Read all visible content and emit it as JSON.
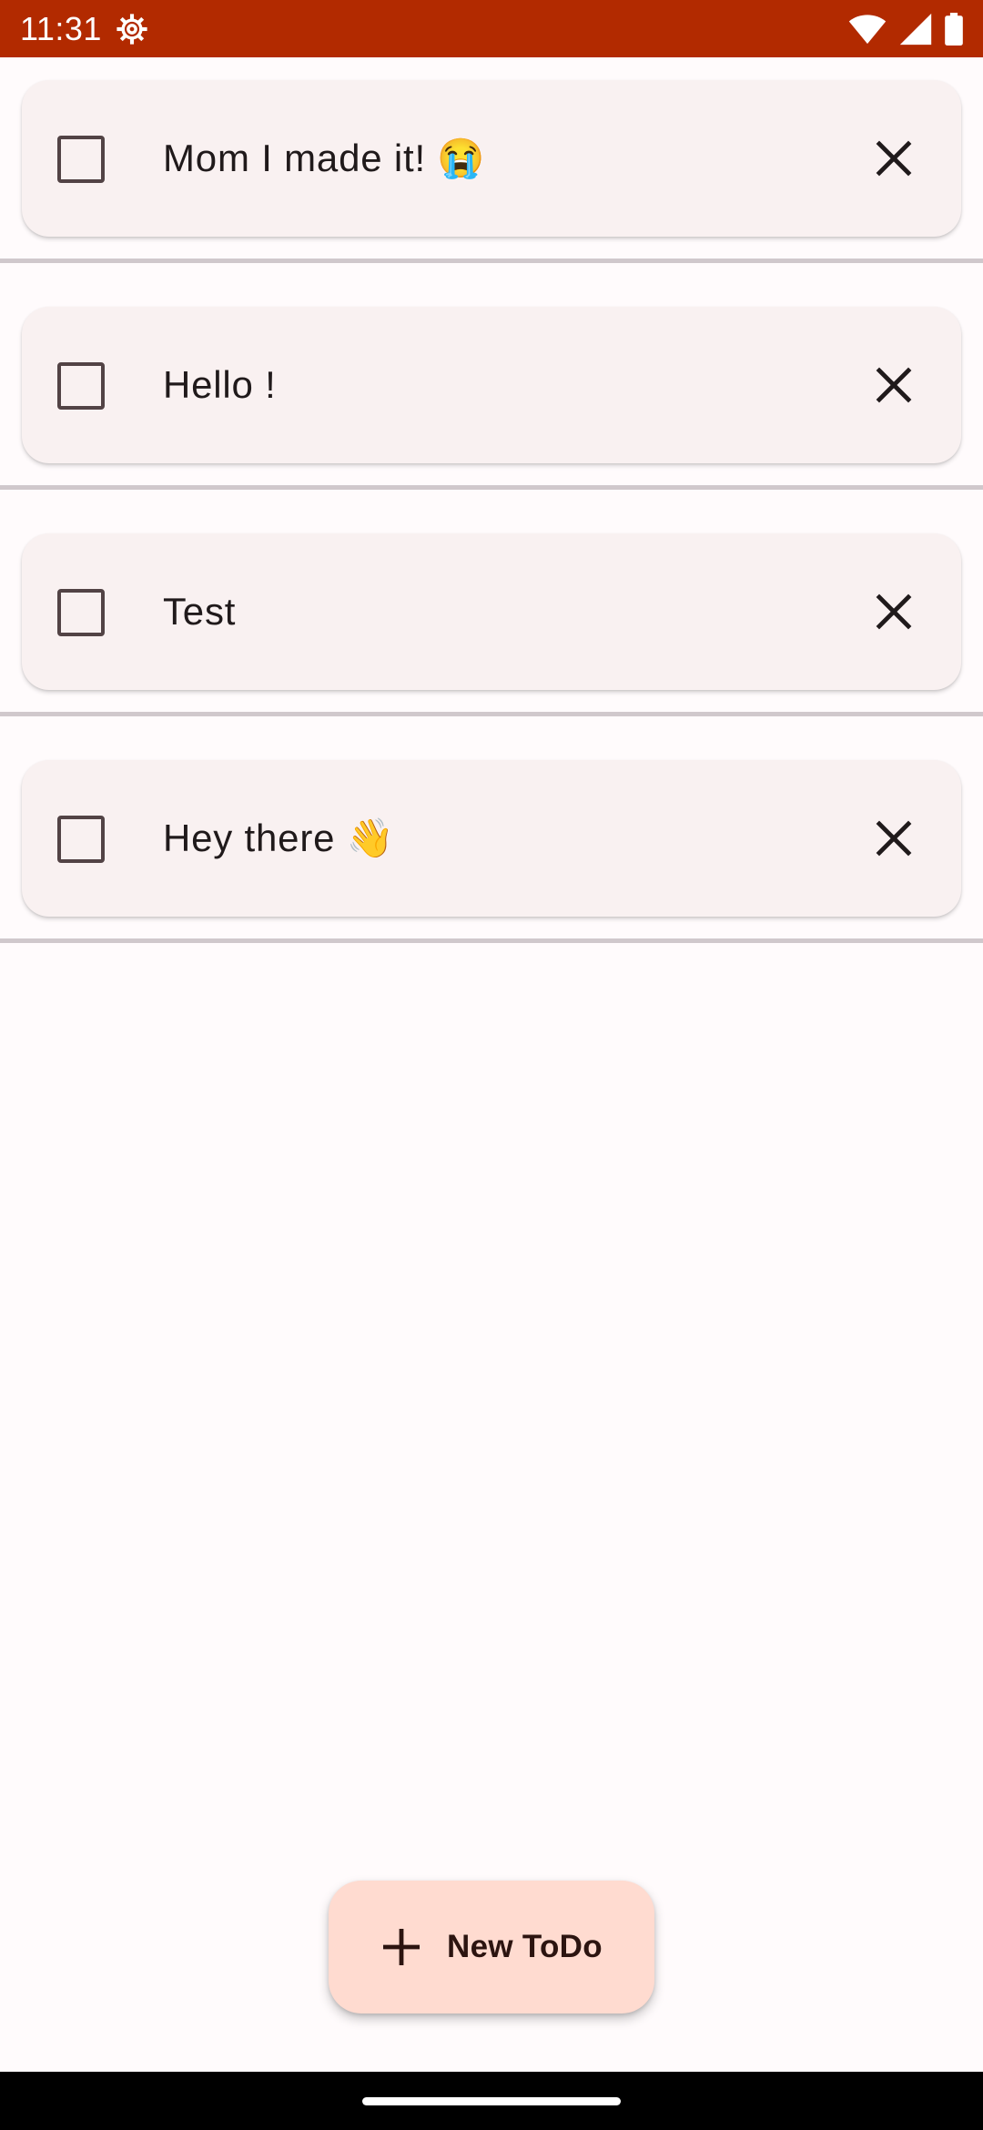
{
  "status_bar": {
    "time": "11:31",
    "background": "#b22a00",
    "icons": [
      "settings-gear-icon",
      "wifi-icon",
      "cellular-signal-icon",
      "battery-icon"
    ]
  },
  "todos": [
    {
      "text": "Mom I made it! 😭",
      "checked": false
    },
    {
      "text": "Hello !",
      "checked": false
    },
    {
      "text": "Test",
      "checked": false
    },
    {
      "text": "Hey there 👋",
      "checked": false
    }
  ],
  "fab": {
    "label": "New ToDo",
    "icon": "plus-icon"
  },
  "colors": {
    "background": "#fffbfc",
    "card": "#f9f1f1",
    "text": "#201a1b",
    "divider": "#d0c8cc",
    "checkbox_border": "#524345",
    "fab_background": "#ffdbd0",
    "fab_text": "#2c1410"
  }
}
